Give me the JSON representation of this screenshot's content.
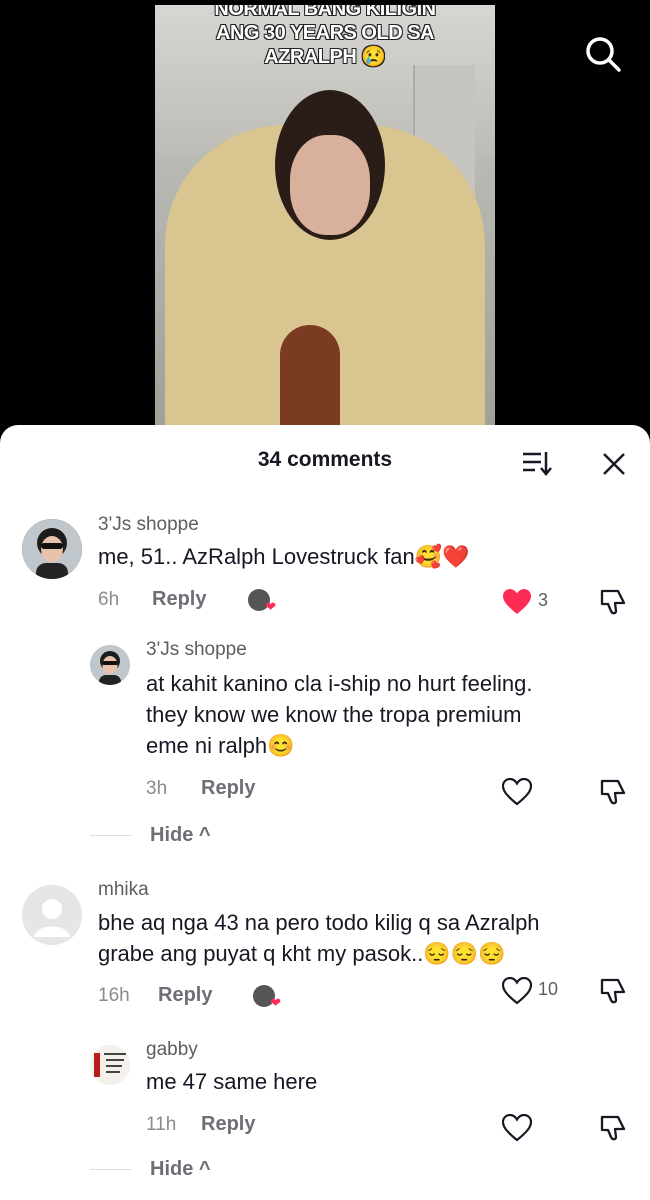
{
  "video": {
    "caption_line1": "NORMAL BANG KILIGIN",
    "caption_line2": "ANG 30 YEARS OLD SA",
    "caption_line3": "AZRALPH 😢",
    "search_icon": "search-icon"
  },
  "sheet": {
    "title": "34 comments",
    "sort_icon": "sort-icon",
    "close_icon": "close-icon"
  },
  "comments": [
    {
      "user": "3'Js shoppe",
      "text": "me, 51.. AzRalph Lovestruck fan🥰❤️",
      "time": "6h",
      "reply": "Reply",
      "likes": "3",
      "liked": true
    },
    {
      "user": "3'Js shoppe",
      "text_lines": [
        "at kahit kanino cla i-ship no hurt feeling.",
        "they know we know the tropa premium",
        "eme ni ralph😊"
      ],
      "time": "3h",
      "reply": "Reply",
      "hide": "Hide ^"
    },
    {
      "user": "mhika",
      "text_lines": [
        "bhe aq nga 43 na pero todo kilig q sa Azralph",
        "grabe ang puyat q kht my pasok..😔😔😔"
      ],
      "time": "16h",
      "reply": "Reply",
      "likes": "10"
    },
    {
      "user": "gabby",
      "text": "me 47 same here",
      "time": "11h",
      "reply": "Reply",
      "hide": "Hide ^"
    }
  ],
  "colors": {
    "liked": "#fe2c55",
    "text": "#161823",
    "muted": "#8a8b91"
  }
}
